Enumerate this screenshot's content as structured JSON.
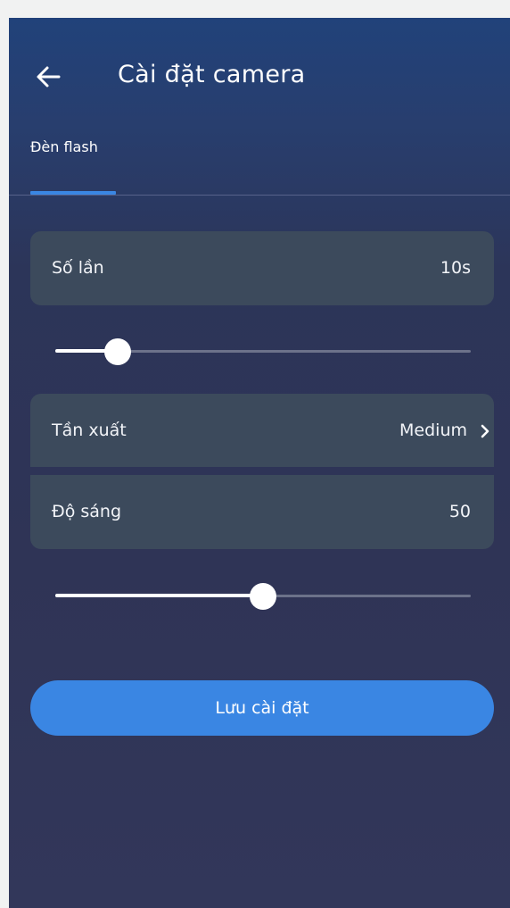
{
  "header": {
    "title": "Cài đặt camera",
    "back_icon": "arrow-left-icon"
  },
  "tabs": [
    {
      "label": "Đèn flash",
      "active": true
    }
  ],
  "settings": {
    "count": {
      "label": "Số lần",
      "value": "10s",
      "slider_fraction": 0.15
    },
    "frequency": {
      "label": "Tần xuất",
      "value": "Medium",
      "icon": "chevron-right-icon"
    },
    "brightness": {
      "label": "Độ sáng",
      "value": "50",
      "slider_fraction": 0.5
    }
  },
  "save_button": {
    "label": "Lưu cài đặt"
  },
  "colors": {
    "accent": "#3a86e3",
    "row_background": "#3c4a5c",
    "text": "#ffffff"
  }
}
